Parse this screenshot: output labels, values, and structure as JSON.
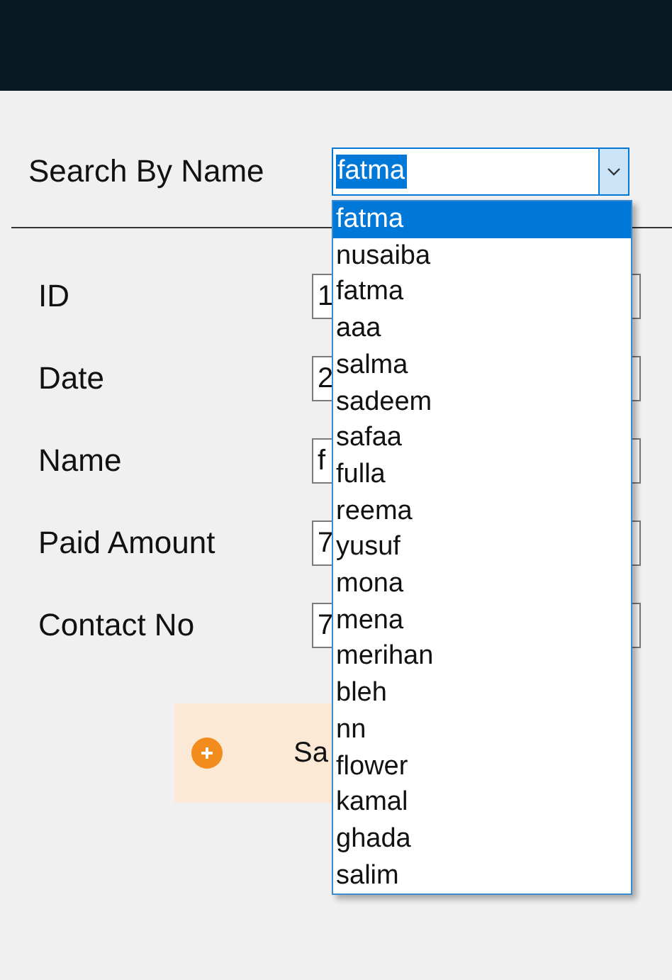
{
  "search": {
    "label": "Search By Name",
    "value": "fatma"
  },
  "dropdown": {
    "expanded": true,
    "items": [
      {
        "label": "fatma",
        "selected": true
      },
      {
        "label": "nusaiba",
        "selected": false
      },
      {
        "label": "fatma",
        "selected": false
      },
      {
        "label": "aaa",
        "selected": false
      },
      {
        "label": "salma",
        "selected": false
      },
      {
        "label": "sadeem",
        "selected": false
      },
      {
        "label": "safaa",
        "selected": false
      },
      {
        "label": "fulla",
        "selected": false
      },
      {
        "label": "reema",
        "selected": false
      },
      {
        "label": "yusuf",
        "selected": false
      },
      {
        "label": "mona",
        "selected": false
      },
      {
        "label": "mena",
        "selected": false
      },
      {
        "label": "merihan",
        "selected": false
      },
      {
        "label": "bleh",
        "selected": false
      },
      {
        "label": "nn",
        "selected": false
      },
      {
        "label": "flower",
        "selected": false
      },
      {
        "label": "kamal",
        "selected": false
      },
      {
        "label": "ghada",
        "selected": false
      },
      {
        "label": "salim",
        "selected": false
      }
    ]
  },
  "fields": [
    {
      "label": "ID",
      "value": "1"
    },
    {
      "label": "Date",
      "value": "2"
    },
    {
      "label": "Name",
      "value": "f"
    },
    {
      "label": "Paid Amount",
      "value": "7"
    },
    {
      "label": "Contact No",
      "value": "7"
    }
  ],
  "save_button": {
    "label": "Sa"
  }
}
